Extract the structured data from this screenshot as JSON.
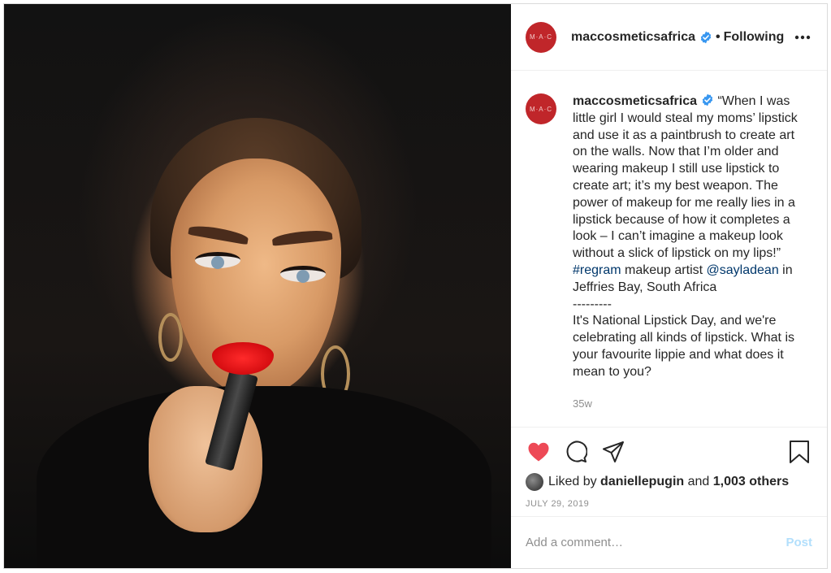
{
  "account": {
    "username": "maccosmeticsafrica",
    "avatar_text": "M·A·C",
    "follow_state": "Following",
    "dot": "•"
  },
  "caption": {
    "text": "“When I was little girl I would steal my moms’ lipstick and use it as a paintbrush to create art on the walls. Now that I’m older and wearing makeup I still use lipstick to create art; it’s my best weapon. The power of makeup for me really lies in a lipstick because of how it completes a look – I can’t imagine a makeup look without a slick of lipstick on my lips!”",
    "hashtag": "#regram",
    "mid_text": "makeup artist",
    "mention": "@sayladean",
    "location_text": "in Jeffries Bay, South Africa",
    "separator": "---------",
    "body2": "It's National Lipstick Day, and we're celebrating all kinds of lipstick. What is your favourite lippie and what does it mean to you?",
    "time_ago": "35w"
  },
  "engagement": {
    "liked_prefix": "Liked by",
    "liked_user": "daniellepugin",
    "and_text": "and",
    "others": "1,003 others",
    "date": "JULY 29, 2019"
  },
  "comment": {
    "placeholder": "Add a comment…",
    "post_label": "Post"
  },
  "icons": {
    "like": "heart-icon",
    "comment": "comment-icon",
    "share": "share-icon",
    "save": "bookmark-icon",
    "more": "more-icon",
    "verified": "verified-badge-icon"
  },
  "colors": {
    "like_active": "#ed4956",
    "verified": "#3897f0",
    "link": "#00376b",
    "post_disabled": "#b2dffc",
    "brand_avatar": "#c0262a"
  }
}
